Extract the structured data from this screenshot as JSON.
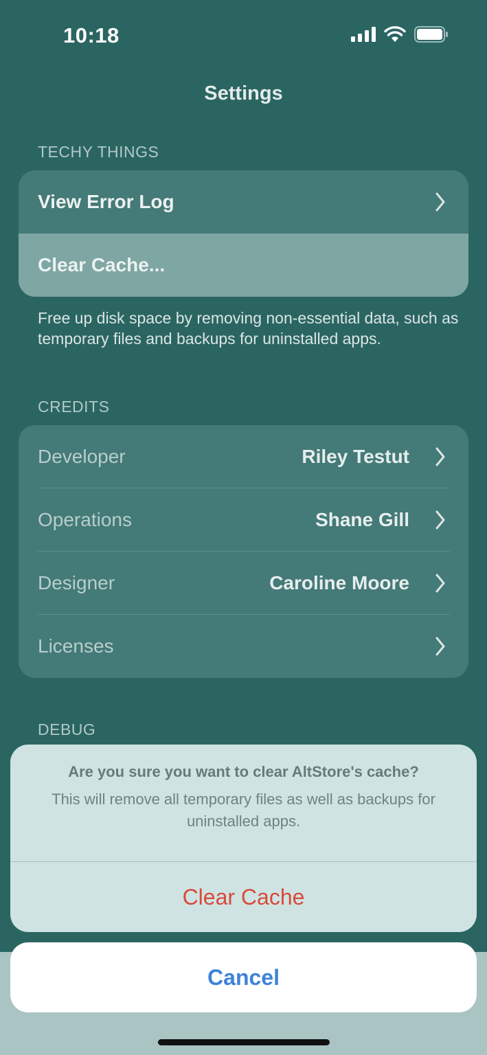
{
  "status_bar": {
    "time": "10:18",
    "icons": [
      "cellular-signal-icon",
      "wifi-icon",
      "battery-icon"
    ]
  },
  "nav": {
    "title": "Settings"
  },
  "techy": {
    "header": "TECHY THINGS",
    "items": [
      {
        "label": "View Error Log"
      },
      {
        "label": "Clear Cache..."
      }
    ],
    "footer": "Free up disk space by removing non-essential data, such as temporary files and backups for uninstalled apps."
  },
  "credits": {
    "header": "CREDITS",
    "items": [
      {
        "label": "Developer",
        "value": "Riley Testut"
      },
      {
        "label": "Operations",
        "value": "Shane Gill"
      },
      {
        "label": "Designer",
        "value": "Caroline Moore"
      },
      {
        "label": "Licenses",
        "value": ""
      }
    ]
  },
  "debug": {
    "header": "DEBUG"
  },
  "action_sheet": {
    "title": "Are you sure you want to clear AltStore's cache?",
    "message": "This will remove all temporary files as well as backups for uninstalled apps.",
    "destructive_label": "Clear Cache",
    "cancel_label": "Cancel"
  },
  "colors": {
    "background": "#2b6562",
    "destructive": "#d84a3a",
    "accent": "#3f82d8"
  }
}
